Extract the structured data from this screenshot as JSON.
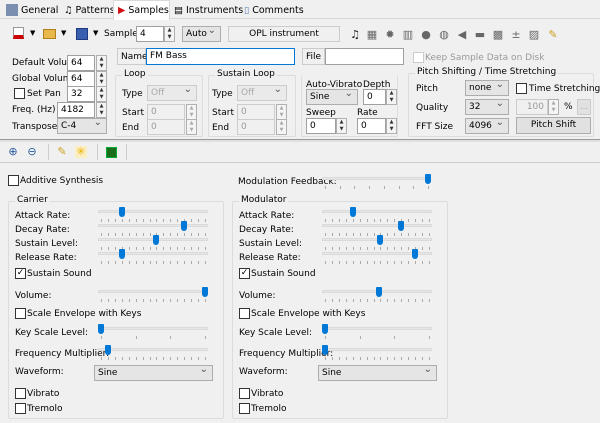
{
  "tabs": [
    {
      "label": "General",
      "icon": "general-icon"
    },
    {
      "label": "Patterns",
      "icon": "music-note-icon"
    },
    {
      "label": "Samples",
      "icon": "samples-icon",
      "active": true
    },
    {
      "label": "Instruments",
      "icon": "keyboard-icon"
    },
    {
      "label": "Comments",
      "icon": "document-icon"
    }
  ],
  "toolbar": {
    "sample_label": "Sample",
    "sample_value": "4",
    "mode": "Auto",
    "sample_type": "OPL instrument"
  },
  "sample": {
    "default_volume_label": "Default Volume",
    "default_volume": "64",
    "global_volume_label": "Global Volume",
    "global_volume": "64",
    "set_pan_label": "Set Pan",
    "set_pan_checked": false,
    "pan": "32",
    "freq_label": "Freq. (Hz)",
    "freq": "4182",
    "transpose_label": "Transpose",
    "transpose": "C-4"
  },
  "name": {
    "label": "Name",
    "value": "FM Bass"
  },
  "file": {
    "label": "File",
    "value": ""
  },
  "keep_on_disk": {
    "label": "Keep Sample Data on Disk",
    "checked": false
  },
  "loop": {
    "title": "Loop",
    "type_label": "Type",
    "type": "Off",
    "start_label": "Start",
    "start": "0",
    "end_label": "End",
    "end": "0"
  },
  "sustain_loop": {
    "title": "Sustain Loop",
    "type_label": "Type",
    "type": "Off",
    "start_label": "Start",
    "start": "0",
    "end_label": "End",
    "end": "0"
  },
  "vibrato": {
    "title": "Auto-Vibrato",
    "type": "Sine",
    "depth_label": "Depth",
    "depth": "0",
    "sweep_label": "Sweep",
    "sweep": "0",
    "rate_label": "Rate",
    "rate": "0"
  },
  "pitch": {
    "title": "Pitch Shifting / Time Stretching",
    "pitch_label": "Pitch",
    "pitch": "none",
    "time_stretch_label": "Time Stretching",
    "time_stretch_checked": false,
    "quality_label": "Quality",
    "quality": "32",
    "stretch_value": "100",
    "percent": "%",
    "more": "...",
    "fft_label": "FFT Size",
    "fft": "4096",
    "pitch_shift_button": "Pitch Shift"
  },
  "opl": {
    "additive_label": "Additive Synthesis",
    "additive_checked": false,
    "feedback_label": "Modulation Feedback:",
    "feedback": {
      "value": 7,
      "min": 0,
      "max": 7
    },
    "operators": [
      {
        "title": "Carrier",
        "attack": 3,
        "decay": 12,
        "sustain": 8,
        "release": 3,
        "sustain_sound": true,
        "volume": 63,
        "scale_env": false,
        "key_scale": 0,
        "freq_mult": 1,
        "waveform": "Sine",
        "vibrato": false,
        "tremolo": false
      },
      {
        "title": "Modulator",
        "attack": 4,
        "decay": 11,
        "sustain": 8,
        "release": 13,
        "sustain_sound": true,
        "volume": 33,
        "scale_env": false,
        "key_scale": 0,
        "freq_mult": 0,
        "waveform": "Sine",
        "vibrato": false,
        "tremolo": false
      }
    ],
    "labels": {
      "attack": "Attack Rate:",
      "decay": "Decay Rate:",
      "sustain": "Sustain Level:",
      "release": "Release Rate:",
      "sustain_sound": "Sustain Sound",
      "volume": "Volume:",
      "scale_env": "Scale Envelope with Keys",
      "key_scale": "Key Scale Level:",
      "freq_mult": "Frequency Multiplier:",
      "waveform": "Waveform:",
      "vibrato": "Vibrato",
      "tremolo": "Tremolo"
    }
  }
}
